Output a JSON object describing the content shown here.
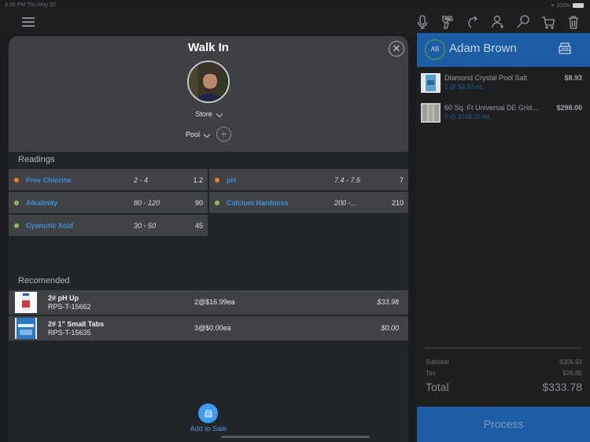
{
  "status_bar": {
    "time": "4:36 PM  Thu May 20",
    "battery": "100%"
  },
  "toolbar": {
    "icons": [
      "microphone-icon",
      "barcode-scanner-icon",
      "refresh-icon",
      "add-user-icon",
      "search-icon",
      "cart-icon",
      "trash-icon"
    ]
  },
  "modal": {
    "title": "Walk In",
    "store_label": "Store",
    "pool_label": "Pool",
    "readings_label": "Readings",
    "readings": [
      {
        "name": "Free Chlorine",
        "range": "2 - 4",
        "value": "1.2",
        "status_color": "#f07a22"
      },
      {
        "name": "pH",
        "range": "7.4 - 7.6",
        "value": "7",
        "status_color": "#f07a22"
      },
      {
        "name": "Alkalinity",
        "range": "80 - 120",
        "value": "90",
        "status_color": "#86c04f"
      },
      {
        "name": "Calcium Hardness",
        "range": "200 -...",
        "value": "210",
        "status_color": "#86c04f"
      },
      {
        "name": "Cyanuric Acid",
        "range": "30 - 50",
        "value": "45",
        "status_color": "#86c04f"
      }
    ],
    "recommended_label": "Recomended",
    "recommended": [
      {
        "name": "2# pH Up",
        "sku": "RPS-T-15662",
        "qty": "2@$16.99ea",
        "total": "$33.98"
      },
      {
        "name": "2# 1\" Small Tabs",
        "sku": "RPS-T-15635",
        "qty": "3@$0.00ea",
        "total": "$0.00"
      }
    ],
    "add_to_sale_label": "Add to Sale"
  },
  "cart": {
    "customer_initials": "AB",
    "customer_name": "Adam Brown",
    "items": [
      {
        "name": "Diamond Crystal Pool Salt",
        "qty": "1 @ $8.93 ea.",
        "price": "$8.93"
      },
      {
        "name": "60 Sq. Ft Universal DE Grid...",
        "qty": "2 @ $149.00 ea.",
        "price": "$298.00"
      }
    ],
    "subtotal_label": "Subtotal",
    "subtotal": "$306.93",
    "tax_label": "Tax",
    "tax": "$26.85",
    "total_label": "Total",
    "total": "$333.78",
    "process_label": "Process"
  },
  "colors": {
    "accent_blue": "#1d5da6",
    "link_blue": "#3c8fd9",
    "warn": "#f07a22",
    "ok": "#86c04f"
  }
}
